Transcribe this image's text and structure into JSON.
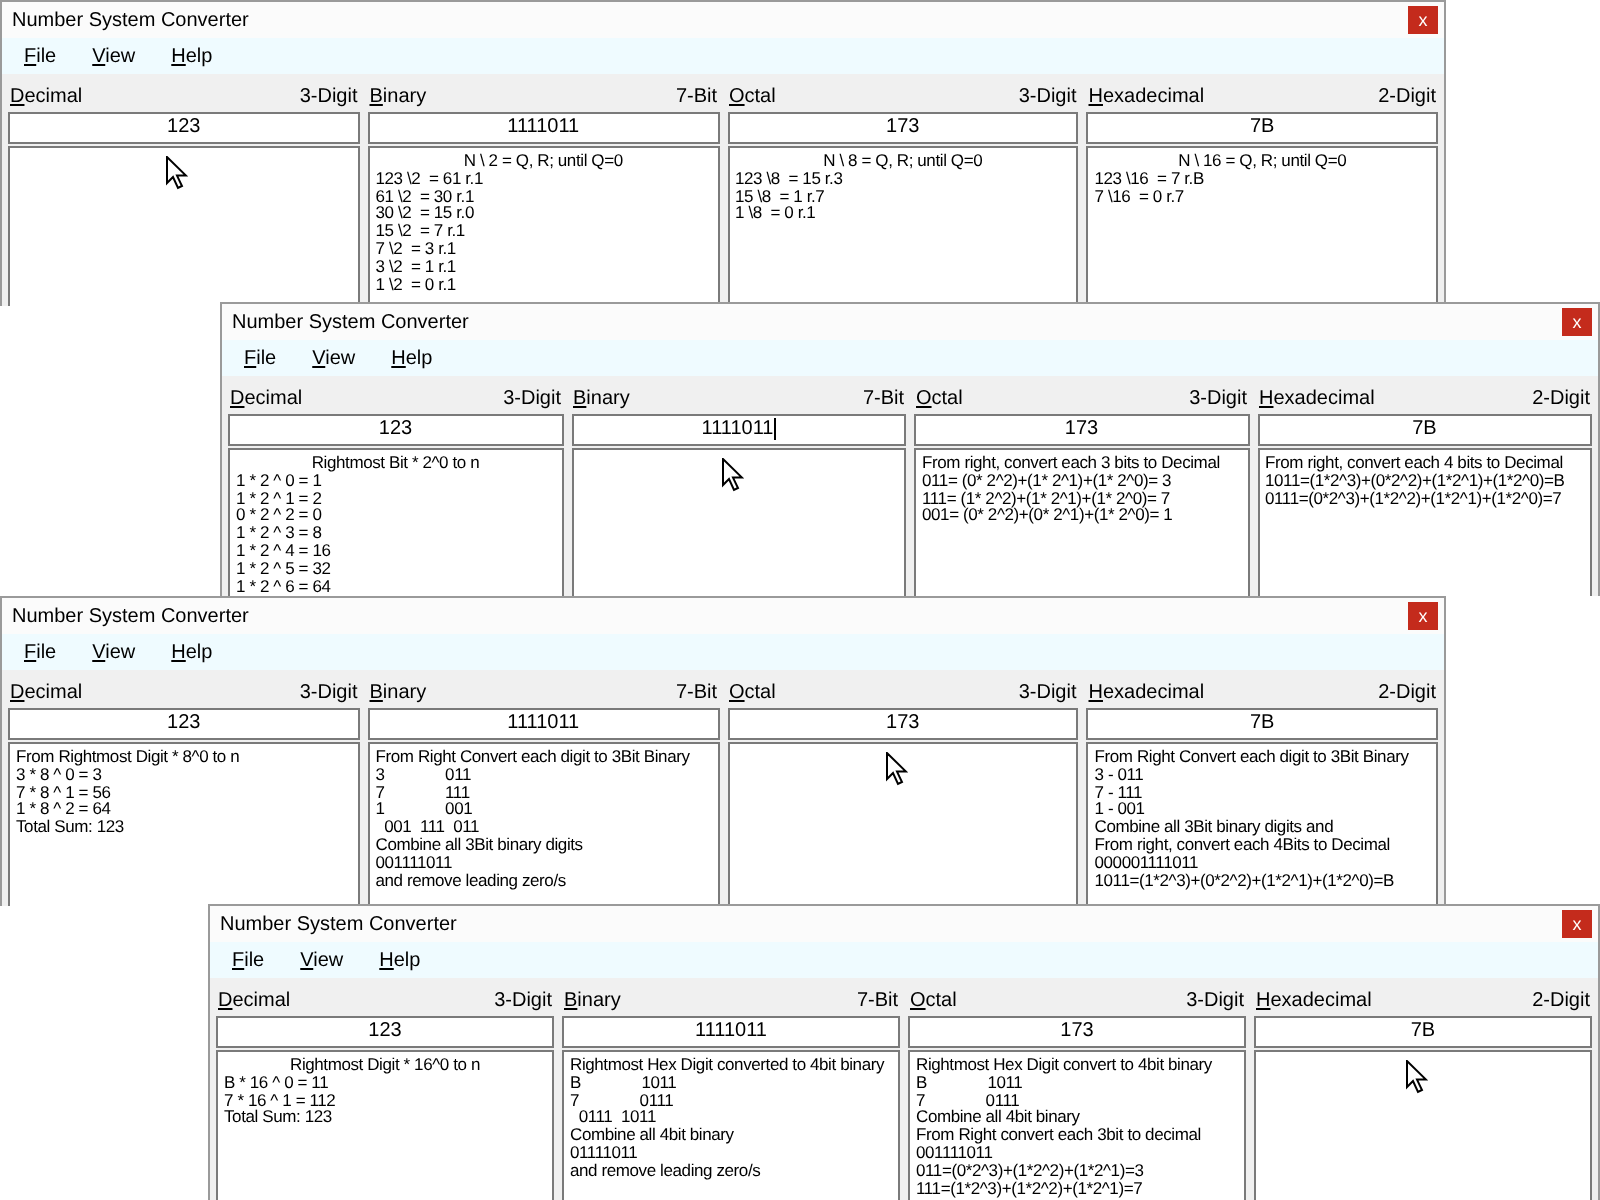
{
  "windows": [
    {
      "title": "Number System Converter",
      "close": "x",
      "menu": [
        "File",
        "View",
        "Help"
      ],
      "columns": [
        {
          "label": "Decimal",
          "digits": "3-Digit",
          "value": "123",
          "text_caret": false,
          "pointer": true
        },
        {
          "label": "Binary",
          "digits": "7-Bit",
          "value": "1111011",
          "text_caret": false,
          "pointer": false,
          "heading": "N \\ 2 = Q, R; until Q=0",
          "lines": [
            "123 \\2  = 61 r.1",
            "61 \\2  = 30 r.1",
            "30 \\2  = 15 r.0",
            "15 \\2  = 7 r.1",
            "7 \\2  = 3 r.1",
            "3 \\2  = 1 r.1",
            "1 \\2  = 0 r.1"
          ]
        },
        {
          "label": "Octal",
          "digits": "3-Digit",
          "value": "173",
          "text_caret": false,
          "pointer": false,
          "heading": "N \\ 8 = Q, R; until Q=0",
          "lines": [
            "123 \\8  = 15 r.3",
            "15 \\8  = 1 r.7",
            "1 \\8  = 0 r.1"
          ]
        },
        {
          "label": "Hexadecimal",
          "digits": "2-Digit",
          "value": "7B",
          "text_caret": false,
          "pointer": false,
          "heading": "N \\ 16 = Q, R; until Q=0",
          "lines": [
            "123 \\16  = 7 r.B",
            "7 \\16  = 0 r.7"
          ]
        }
      ]
    },
    {
      "title": "Number System Converter",
      "close": "x",
      "menu": [
        "File",
        "View",
        "Help"
      ],
      "columns": [
        {
          "label": "Decimal",
          "digits": "3-Digit",
          "value": "123",
          "text_caret": false,
          "pointer": false,
          "heading": "Rightmost Bit * 2^0 to n",
          "lines": [
            "1 * 2 ^ 0 = 1",
            "1 * 2 ^ 1 = 2",
            "0 * 2 ^ 2 = 0",
            "1 * 2 ^ 3 = 8",
            "1 * 2 ^ 4 = 16",
            "1 * 2 ^ 5 = 32",
            "1 * 2 ^ 6 = 64"
          ]
        },
        {
          "label": "Binary",
          "digits": "7-Bit",
          "value": "1111011",
          "text_caret": true,
          "pointer": true
        },
        {
          "label": "Octal",
          "digits": "3-Digit",
          "value": "173",
          "text_caret": false,
          "pointer": false,
          "lines": [
            "From right, convert each 3 bits to Decimal",
            "011= (0* 2^2)+(1* 2^1)+(1* 2^0)= 3",
            "111= (1* 2^2)+(1* 2^1)+(1* 2^0)= 7",
            "001= (0* 2^2)+(0* 2^1)+(1* 2^0)= 1"
          ]
        },
        {
          "label": "Hexadecimal",
          "digits": "2-Digit",
          "value": "7B",
          "text_caret": false,
          "pointer": false,
          "lines": [
            "From right, convert each 4 bits to Decimal",
            "1011=(1*2^3)+(0*2^2)+(1*2^1)+(1*2^0)=B",
            "0111=(0*2^3)+(1*2^2)+(1*2^1)+(1*2^0)=7"
          ]
        }
      ]
    },
    {
      "title": "Number System Converter",
      "close": "x",
      "menu": [
        "File",
        "View",
        "Help"
      ],
      "columns": [
        {
          "label": "Decimal",
          "digits": "3-Digit",
          "value": "123",
          "text_caret": false,
          "pointer": false,
          "lines": [
            "From Rightmost Digit * 8^0 to n",
            "3 * 8 ^ 0 = 3",
            "7 * 8 ^ 1 = 56",
            "1 * 8 ^ 2 = 64",
            "Total Sum: 123"
          ]
        },
        {
          "label": "Binary",
          "digits": "7-Bit",
          "value": "1111011",
          "text_caret": false,
          "pointer": false,
          "lines": [
            "From Right Convert each digit to 3Bit Binary",
            "3              011",
            "7              111",
            "1              001",
            "  001  111  011",
            "Combine all 3Bit binary digits",
            "001111011",
            "and remove leading zero/s"
          ]
        },
        {
          "label": "Octal",
          "digits": "3-Digit",
          "value": "173",
          "text_caret": false,
          "pointer": true
        },
        {
          "label": "Hexadecimal",
          "digits": "2-Digit",
          "value": "7B",
          "text_caret": false,
          "pointer": false,
          "lines": [
            "From Right Convert each digit to 3Bit Binary",
            "3 - 011",
            "7 - 111",
            "1 - 001",
            "Combine all 3Bit binary digits and",
            "From right, convert each 4Bits to Decimal",
            "000001111011",
            "1011=(1*2^3)+(0*2^2)+(1*2^1)+(1*2^0)=B"
          ]
        }
      ]
    },
    {
      "title": "Number System Converter",
      "close": "x",
      "menu": [
        "File",
        "View",
        "Help"
      ],
      "columns": [
        {
          "label": "Decimal",
          "digits": "3-Digit",
          "value": "123",
          "text_caret": false,
          "pointer": false,
          "heading": "Rightmost Digit * 16^0 to n",
          "lines": [
            "B * 16 ^ 0 = 11",
            "7 * 16 ^ 1 = 112",
            "Total Sum: 123"
          ]
        },
        {
          "label": "Binary",
          "digits": "7-Bit",
          "value": "1111011",
          "text_caret": false,
          "pointer": false,
          "lines": [
            "Rightmost Hex Digit converted to 4bit binary",
            "B              1011",
            "7              0111",
            "  0111  1011",
            "Combine all 4bit binary",
            "01111011",
            "and remove leading zero/s"
          ]
        },
        {
          "label": "Octal",
          "digits": "3-Digit",
          "value": "173",
          "text_caret": false,
          "pointer": false,
          "lines": [
            "Rightmost Hex Digit convert to 4bit binary",
            "B              1011",
            "7              0111",
            "Combine all 4bit binary",
            "From Right convert each 3bit to decimal",
            "001111011",
            "011=(0*2^3)+(1*2^2)+(1*2^1)=3",
            "111=(1*2^3)+(1*2^2)+(1*2^1)=7"
          ]
        },
        {
          "label": "Hexadecimal",
          "digits": "2-Digit",
          "value": "7B",
          "text_caret": false,
          "pointer": true
        }
      ]
    }
  ]
}
